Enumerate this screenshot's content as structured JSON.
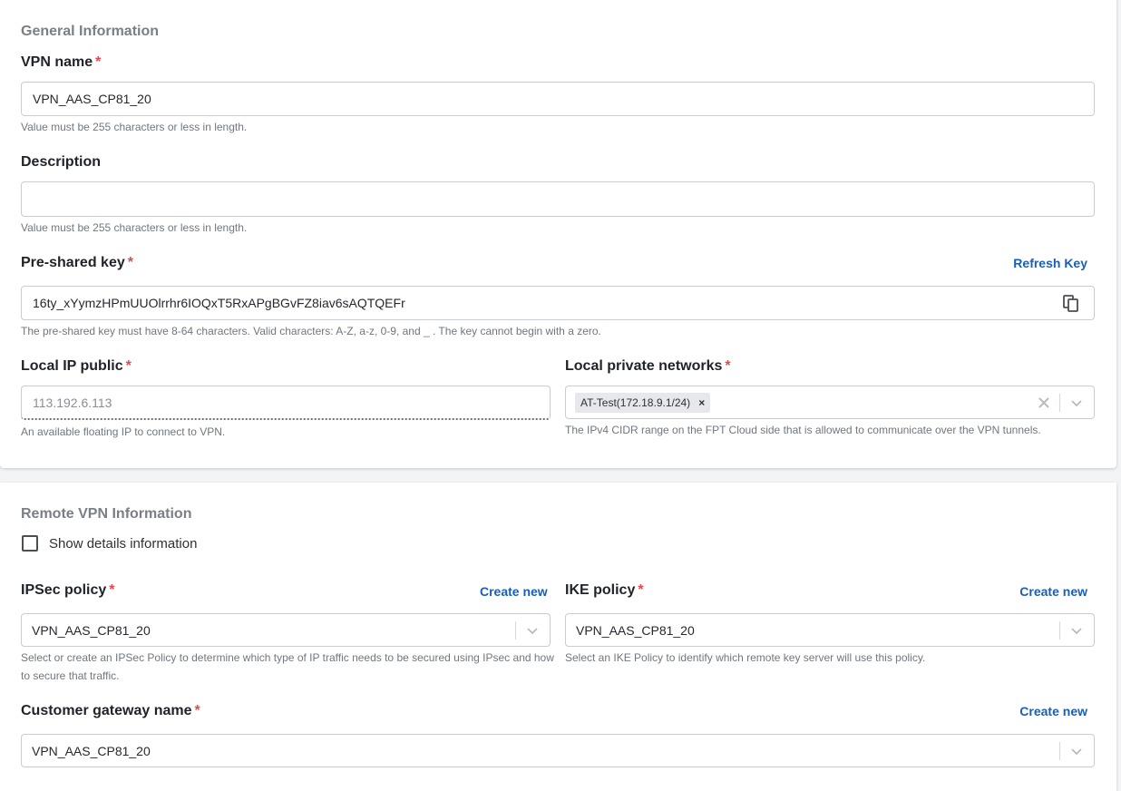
{
  "general": {
    "section_title": "General Information",
    "vpn_name": {
      "label": "VPN name",
      "required_mark": "*",
      "value": "VPN_AAS_CP81_20",
      "helper": "Value must be 255 characters or less in length."
    },
    "description": {
      "label": "Description",
      "value": "",
      "helper": "Value must be 255 characters or less in length."
    },
    "pre_shared_key": {
      "label": "Pre-shared key",
      "required_mark": "*",
      "refresh_label": "Refresh Key",
      "value": "16ty_xYymzHPmUUOlrrhr6IOQxT5RxAPgBGvFZ8iav6sAQTQEFr",
      "copy_icon": "copy-icon",
      "helper": "The pre-shared key must have 8-64 characters. Valid characters: A-Z, a-z, 0-9, and _ . The key cannot begin with a zero."
    },
    "local_ip_public": {
      "label": "Local IP public",
      "required_mark": "*",
      "value": "113.192.6.113",
      "helper": "An available floating IP to connect to VPN."
    },
    "local_private_networks": {
      "label": "Local private networks",
      "required_mark": "*",
      "chips": [
        "AT-Test(172.18.9.1/24)"
      ],
      "chip_remove": "×",
      "clear_icon": "clear-icon",
      "helper": "The IPv4 CIDR range on the FPT Cloud side that is allowed to communicate over the VPN tunnels."
    }
  },
  "remote": {
    "section_title": "Remote VPN Information",
    "show_details": {
      "label": "Show details information",
      "checked": false
    },
    "ipsec_policy": {
      "label": "IPSec policy",
      "required_mark": "*",
      "create_label": "Create new",
      "value": "VPN_AAS_CP81_20",
      "helper_line1": "Select or create an IPSec Policy to determine which type of IP traffic needs to be secured using IPsec and how",
      "helper_line2": "to secure that traffic."
    },
    "ike_policy": {
      "label": "IKE policy",
      "required_mark": "*",
      "create_label": "Create new",
      "value": "VPN_AAS_CP81_20",
      "helper": "Select an IKE Policy to identify which remote key server will use this policy."
    },
    "customer_gateway": {
      "label": "Customer gateway name",
      "required_mark": "*",
      "create_label": "Create new",
      "value": "VPN_AAS_CP81_20"
    }
  },
  "colors": {
    "accent_link": "#1a5fb4",
    "required": "#e5484d",
    "section_title": "#7a7f87"
  }
}
